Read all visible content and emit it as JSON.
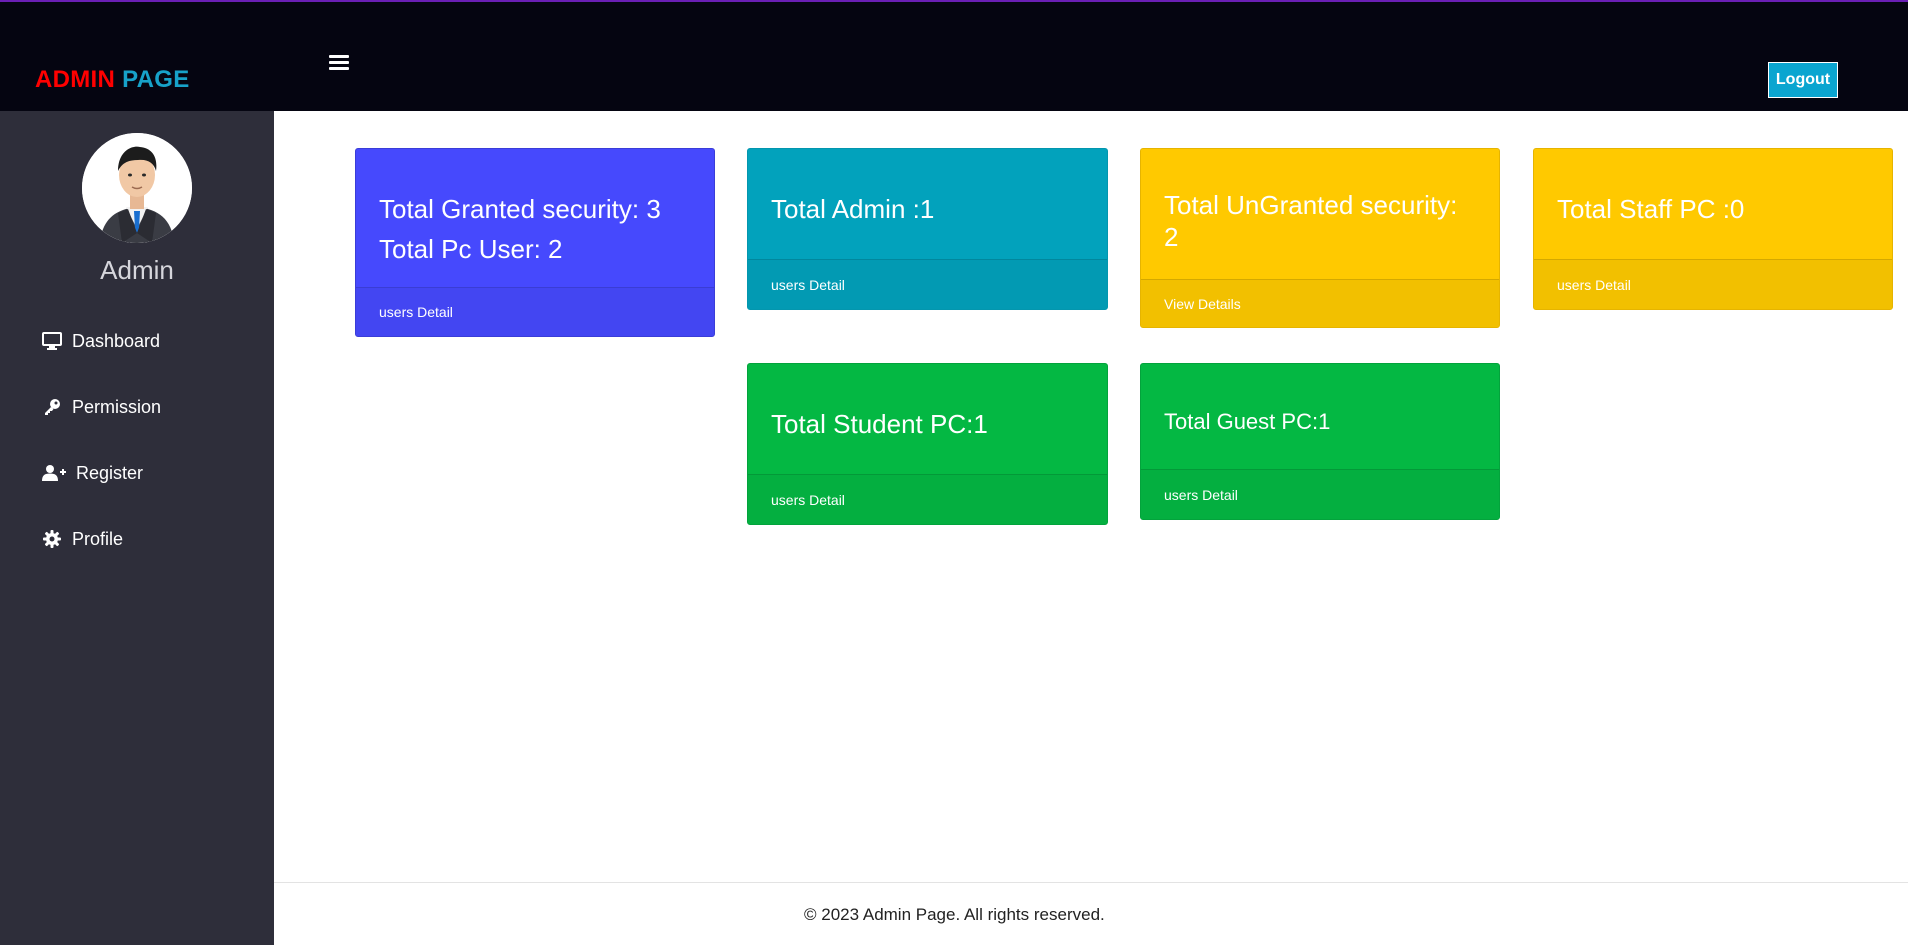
{
  "header": {
    "brand_part1": "ADMIN",
    "brand_part2": "PAGE",
    "logout_label": "Logout"
  },
  "sidebar": {
    "user_name": "Admin",
    "items": [
      {
        "label": "Dashboard",
        "icon": "monitor-icon"
      },
      {
        "label": "Permission",
        "icon": "key-icon"
      },
      {
        "label": "Register",
        "icon": "user-plus-icon"
      },
      {
        "label": "Profile",
        "icon": "gear-icon"
      }
    ]
  },
  "cards": {
    "granted": {
      "line1": "Total Granted security: 3",
      "line2": "Total Pc User: 2",
      "footer": "users Detail",
      "color": "#4649fd"
    },
    "admin": {
      "line1": "Total Admin :1",
      "footer": "users Detail",
      "color": "#02a2bc"
    },
    "ungranted": {
      "line1": "Total UnGranted security: 2",
      "footer": "View Details",
      "color": "#ffc900"
    },
    "staff": {
      "line1": "Total Staff PC :0",
      "footer": "users Detail",
      "color": "#ffc900"
    },
    "student": {
      "line1": "Total Student PC:1",
      "footer": "users Detail",
      "color": "#04b843"
    },
    "guest": {
      "line1": "Total Guest PC:1",
      "footer": "users Detail",
      "color": "#04b843"
    }
  },
  "footer": {
    "copyright": "© 2023 Admin Page. All rights reserved."
  }
}
